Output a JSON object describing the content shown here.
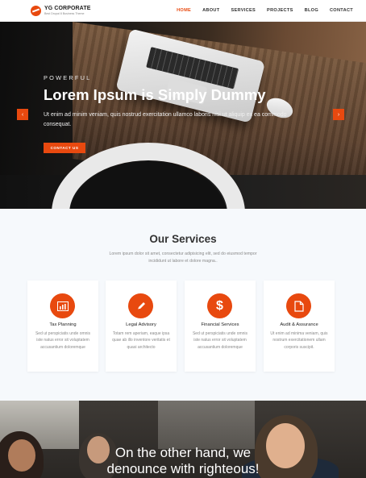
{
  "brand": {
    "name": "YG CORPORATE",
    "tagline": "Best Drupal 8 Business Theme",
    "accent_color": "#e8490f"
  },
  "nav": {
    "items": [
      "HOME",
      "ABOUT",
      "SERVICES",
      "PROJECTS",
      "BLOG",
      "CONTACT"
    ],
    "active": "HOME"
  },
  "hero": {
    "eyebrow": "POWERFUL",
    "title": "Lorem Ipsum is Simply Dummy",
    "text": "Ut enim ad minim veniam, quis nostrud exercitation ullamco laboris nisi ut aliquip ex ea commodo consequat.",
    "button": "CONTACT US",
    "prev_icon": "chevron-left-icon",
    "next_icon": "chevron-right-icon"
  },
  "services": {
    "title": "Our Services",
    "subtitle": "Lorem ipsum dolor sit amet, consectetur adipisicing elit, sed do eiusmod tempor incididunt ut labore et dolore magna..",
    "cards": [
      {
        "icon": "bar-chart-icon",
        "title": "Tax Planning",
        "desc": "Sed ut perspiciatis unde omnis iste natus error sit voluptatem accusantium doloremque"
      },
      {
        "icon": "pencil-icon",
        "title": "Legal Advisory",
        "desc": "Totam rem aperiam, eaque ipsa quae ab illo inventore veritatis et quasi architecto"
      },
      {
        "icon": "dollar-icon",
        "title": "Financial Services",
        "desc": "Sed ut perspiciatis unde omnis iste natus error sit voluptatem accusantium doloremque"
      },
      {
        "icon": "document-icon",
        "title": "Audit & Assurance",
        "desc": "Ut enim ad minima veniam, quis nostrum exercitationem ullam corporis suscipit."
      }
    ]
  },
  "banner": {
    "title_line1": "On the other hand, we",
    "title_line2": "denounce with righteous!"
  }
}
